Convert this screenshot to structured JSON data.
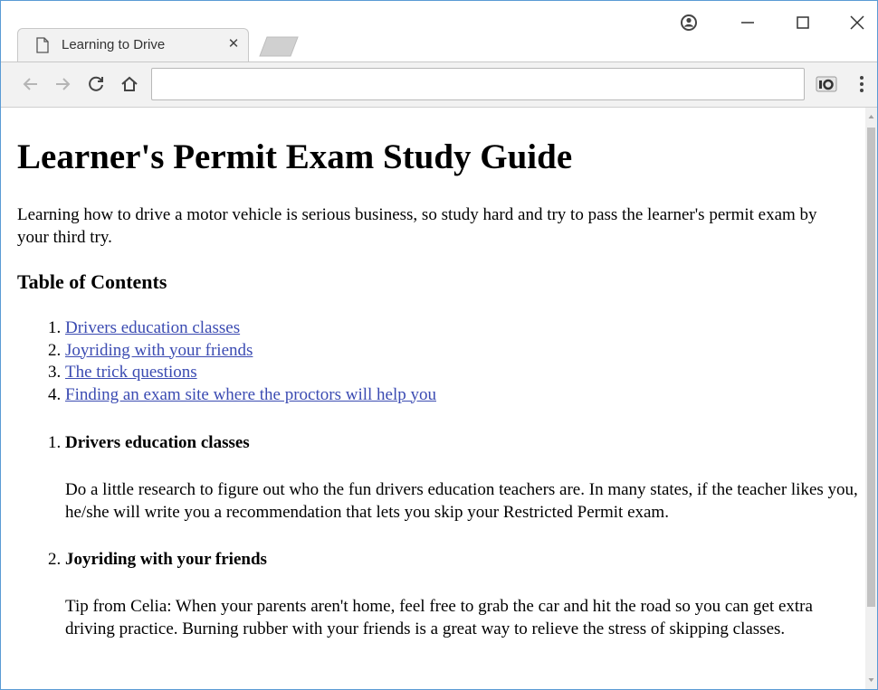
{
  "tab": {
    "title": "Learning to Drive",
    "close_icon": "close-icon",
    "favicon": "document-icon"
  },
  "window_controls": [
    "account-icon",
    "minimize-icon",
    "maximize-icon",
    "close-icon"
  ],
  "toolbar": {
    "back_icon": "back-arrow-icon",
    "forward_icon": "forward-arrow-icon",
    "reload_icon": "reload-icon",
    "home_icon": "home-icon",
    "address_value": "",
    "extension_icon": "extension-icon",
    "menu_icon": "more-menu-icon"
  },
  "page": {
    "heading": "Learner's Permit Exam Study Guide",
    "intro": "Learning how to drive a motor vehicle is serious business, so study hard and try to pass the learner's permit exam by your third try.",
    "toc_heading": "Table of Contents",
    "toc": [
      "Drivers education classes",
      "Joyriding with your friends",
      "The trick questions",
      "Finding an exam site where the proctors will help you"
    ],
    "sections": [
      {
        "title": "Drivers education classes",
        "body": "Do a little research to figure out who the fun drivers education teachers are. In many states, if the teacher likes you, he/she will write you a recommendation that lets you skip your Restricted Permit exam."
      },
      {
        "title": "Joyriding with your friends",
        "body": "Tip from Celia: When your parents aren't home, feel free to grab the car and hit the road so you can get extra driving practice. Burning rubber with your friends is a great way to relieve the stress of skipping classes."
      }
    ]
  },
  "colors": {
    "link": "#3b4bb2",
    "toolbar_bg": "#f2f2f2",
    "window_border": "#5a9bd5"
  }
}
